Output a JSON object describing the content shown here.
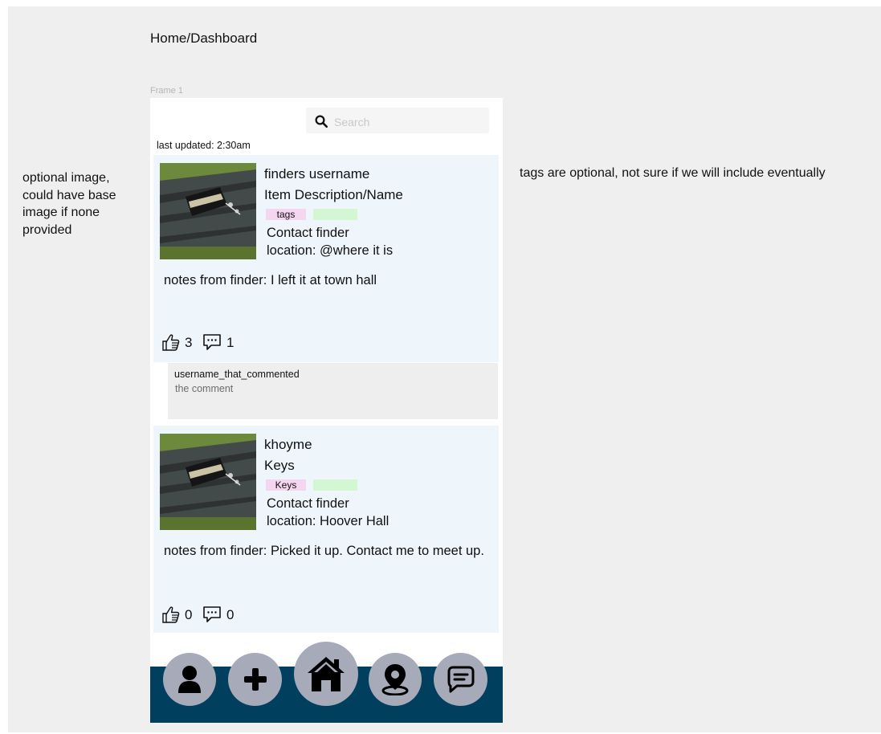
{
  "header": {
    "title": "Home/Dashboard",
    "frame_label": "Frame 1"
  },
  "annotations": {
    "left_note": "optional image, could have base image if none provided",
    "right_note": "tags are optional, not sure if we will include eventually"
  },
  "search": {
    "placeholder": "Search"
  },
  "last_updated": "last updated: 2:30am",
  "posts": [
    {
      "username": "finders username",
      "item": "Item Description/Name",
      "tag": "tags",
      "contact": "Contact finder",
      "location": "location: @where it is",
      "notes": "notes from finder:  I left it at town hall",
      "likes": "3",
      "comments": "1"
    },
    {
      "username": "khoyme",
      "item": "Keys",
      "tag": "Keys",
      "contact": "Contact finder",
      "location": "location: Hoover Hall",
      "notes": "notes from finder:  Picked it up. Contact me to meet up.",
      "likes": "0",
      "comments": "0"
    }
  ],
  "comment": {
    "user": "username_that_commented",
    "text": "the comment"
  },
  "nav": {
    "items": [
      "profile-icon",
      "plus-icon",
      "home-icon",
      "map-pin-icon",
      "chat-icon"
    ],
    "bar_color": "#00405e",
    "button_color": "#a7aab9"
  },
  "colors": {
    "card_bg": "#eef5fb",
    "tag_pink": "#f5d6f1",
    "tag_green": "#d3f7d3"
  }
}
